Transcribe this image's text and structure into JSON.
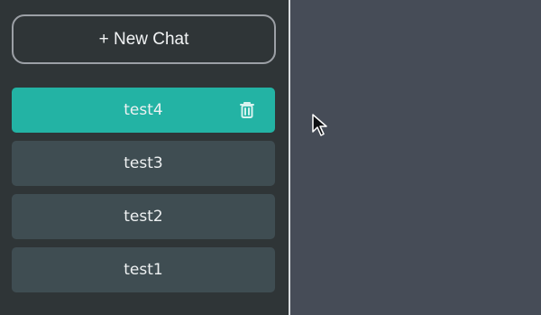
{
  "sidebar": {
    "new_chat_label": "+ New Chat",
    "items": [
      {
        "label": "test4",
        "active": true
      },
      {
        "label": "test3",
        "active": false
      },
      {
        "label": "test2",
        "active": false
      },
      {
        "label": "test1",
        "active": false
      }
    ]
  },
  "colors": {
    "sidebar_bg": "#2f3537",
    "main_bg": "#464c57",
    "active_item": "#23b3a4",
    "item_bg": "#3f4d52"
  },
  "icons": {
    "delete": "trash-icon",
    "pointer": "mouse-cursor-icon"
  }
}
